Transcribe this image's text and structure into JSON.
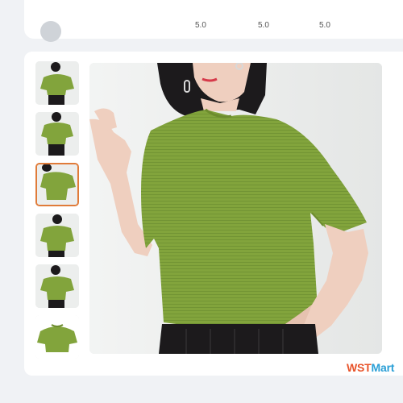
{
  "header": {
    "stats": [
      "5.0",
      "5.0",
      "5.0"
    ]
  },
  "gallery": {
    "selected_index": 2,
    "thumbnails": [
      {
        "name": "thumb-1"
      },
      {
        "name": "thumb-2"
      },
      {
        "name": "thumb-3"
      },
      {
        "name": "thumb-4"
      },
      {
        "name": "thumb-5"
      },
      {
        "name": "thumb-6"
      }
    ],
    "colors": {
      "sweater": "#82a43c",
      "sweater_dark": "#6d8c2e",
      "skin": "#efcfbf",
      "hair": "#1c1a1c",
      "wall": "#eceeed",
      "active_border": "#e07b39"
    }
  },
  "watermark": {
    "part_a": "WST",
    "part_b": "Mart"
  }
}
